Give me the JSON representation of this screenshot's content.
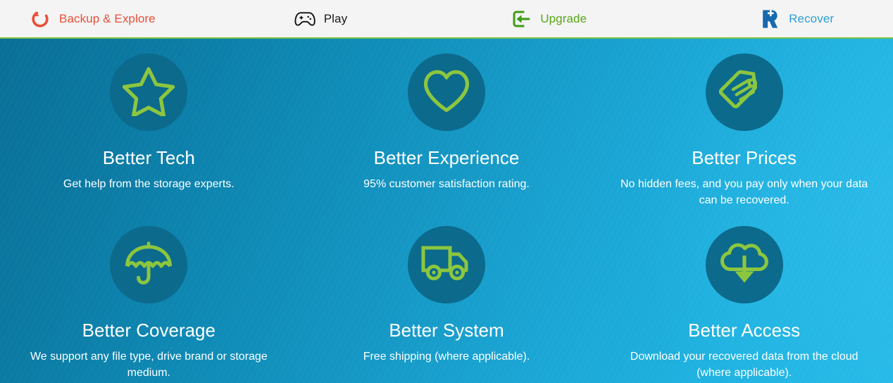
{
  "nav": {
    "items": [
      {
        "id": "backup",
        "label": "Backup & Explore",
        "icon": "refresh-circular-arrow-icon",
        "color": "#e8503a"
      },
      {
        "id": "play",
        "label": "Play",
        "icon": "gamepad-icon",
        "color": "#1a1a1a"
      },
      {
        "id": "upgrade",
        "label": "Upgrade",
        "icon": "login-arrow-icon",
        "color": "#58a618"
      },
      {
        "id": "recover",
        "label": "Recover",
        "icon": "recover-r-icon",
        "color": "#2e9fd4"
      }
    ]
  },
  "hero": {
    "accent_green": "#8cc63f",
    "icon_circle_color": "#0c6a8c",
    "background_from": "#0a6f97",
    "background_to": "#22b8e6",
    "cards": [
      {
        "icon": "star-icon",
        "title": "Better Tech",
        "desc": "Get help from the storage experts."
      },
      {
        "icon": "heart-icon",
        "title": "Better Experience",
        "desc": "95% customer satisfaction rating."
      },
      {
        "icon": "price-tag-icon",
        "title": "Better Prices",
        "desc": "No hidden fees, and you pay only when your data can be recovered."
      },
      {
        "icon": "umbrella-icon",
        "title": "Better Coverage",
        "desc": "We support any file type, drive brand or storage medium."
      },
      {
        "icon": "delivery-truck-icon",
        "title": "Better System",
        "desc": "Free shipping (where applicable)."
      },
      {
        "icon": "cloud-download-icon",
        "title": "Better Access",
        "desc": "Download your recovered data from the cloud (where applicable)."
      }
    ]
  }
}
